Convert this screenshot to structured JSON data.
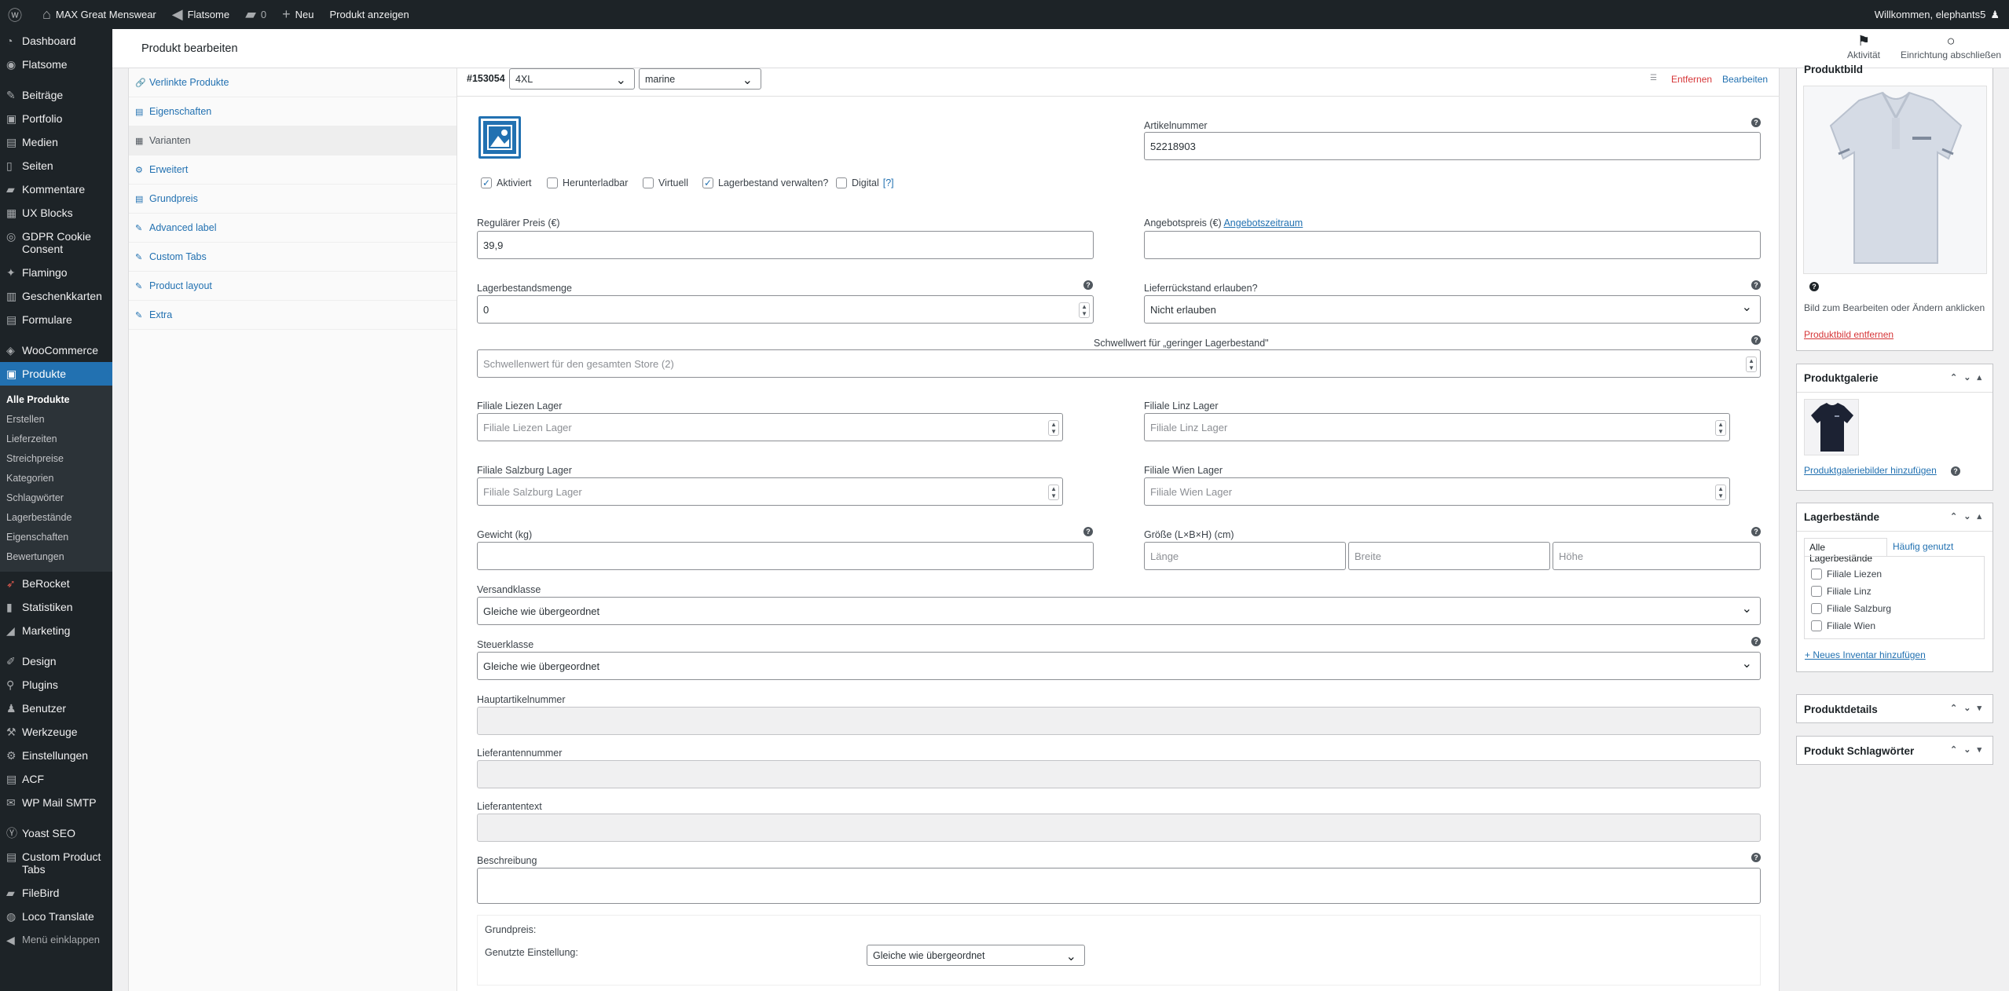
{
  "adminbar": {
    "site_name": "MAX Great Menswear",
    "theme": "Flatsome",
    "comments_count": "0",
    "new_label": "Neu",
    "view_product": "Produkt anzeigen",
    "greeting": "Willkommen, elephants5"
  },
  "menu": {
    "dashboard": "Dashboard",
    "flatsome": "Flatsome",
    "beitraege": "Beiträge",
    "portfolio": "Portfolio",
    "medien": "Medien",
    "seiten": "Seiten",
    "kommentare": "Kommentare",
    "ux_blocks": "UX Blocks",
    "gdpr": "GDPR Cookie Consent",
    "flamingo": "Flamingo",
    "geschenkkarten": "Geschenkkarten",
    "formulare": "Formulare",
    "woocommerce": "WooCommerce",
    "produkte": "Produkte",
    "submenu": [
      "Alle Produkte",
      "Erstellen",
      "Lieferzeiten",
      "Streichpreise",
      "Kategorien",
      "Schlagwörter",
      "Lagerbestände",
      "Eigenschaften",
      "Bewertungen"
    ],
    "berocket": "BeRocket",
    "statistiken": "Statistiken",
    "marketing": "Marketing",
    "design": "Design",
    "plugins": "Plugins",
    "benutzer": "Benutzer",
    "werkzeuge": "Werkzeuge",
    "einstellungen": "Einstellungen",
    "acf": "ACF",
    "wp_mail": "WP Mail SMTP",
    "yoast": "Yoast SEO",
    "custom_tabs": "Custom Product Tabs",
    "filebird": "FileBird",
    "loco": "Loco Translate",
    "collapse": "Menü einklappen"
  },
  "header": {
    "title": "Produkt bearbeiten",
    "activity": "Aktivität",
    "setup": "Einrichtung abschließen"
  },
  "tabs": [
    "Verlinkte Produkte",
    "Eigenschaften",
    "Varianten",
    "Erweitert",
    "Grundpreis",
    "Advanced label",
    "Custom Tabs",
    "Product layout",
    "Extra"
  ],
  "variation": {
    "id": "#153054",
    "size": "4XL",
    "color": "marine",
    "remove": "Entfernen",
    "edit": "Bearbeiten",
    "sku_label": "Artikelnummer",
    "sku": "52218903",
    "cb_active": "Aktiviert",
    "cb_download": "Herunterladbar",
    "cb_virtual": "Virtuell",
    "cb_stock": "Lagerbestand verwalten?",
    "cb_digital": "Digital",
    "cb_digital_help": "[?]",
    "regular_price_label": "Regulärer Preis (€)",
    "regular_price": "39,9",
    "sale_price_label": "Angebotspreis (€)",
    "sale_schedule": "Angebotszeitraum",
    "stock_qty_label": "Lagerbestandsmenge",
    "stock_qty": "0",
    "backorder_label": "Lieferrückstand erlauben?",
    "backorder": "Nicht erlauben",
    "low_stock_label": "Schwellwert für „geringer Lagerbestand\"",
    "low_stock_placeholder": "Schwellenwert für den gesamten Store (2)",
    "liezen_label": "Filiale Liezen Lager",
    "liezen_ph": "Filiale Liezen Lager",
    "linz_label": "Filiale Linz Lager",
    "linz_ph": "Filiale Linz Lager",
    "salzburg_label": "Filiale Salzburg Lager",
    "salzburg_ph": "Filiale Salzburg Lager",
    "wien_label": "Filiale Wien Lager",
    "wien_ph": "Filiale Wien Lager",
    "weight_label": "Gewicht (kg)",
    "dims_label": "Größe (L×B×H) (cm)",
    "length_ph": "Länge",
    "width_ph": "Breite",
    "height_ph": "Höhe",
    "shipping_label": "Versandklasse",
    "shipping": "Gleiche wie übergeordnet",
    "tax_label": "Steuerklasse",
    "tax": "Gleiche wie übergeordnet",
    "main_sku_label": "Hauptartikelnummer",
    "supplier_no_label": "Lieferantennummer",
    "supplier_text_label": "Lieferantentext",
    "desc_label": "Beschreibung",
    "unit_price_title": "Grundpreis:",
    "unit_setting_label": "Genutzte Einstellung:",
    "unit_setting": "Gleiche wie übergeordnet"
  },
  "sidebar": {
    "image_box_title": "Produktbild",
    "image_hint": "Bild zum Bearbeiten oder Ändern anklicken",
    "remove_image": "Produktbild entfernen",
    "gallery_title": "Produktgalerie",
    "gallery_add": "Produktgaleriebilder hinzufügen",
    "stock_title": "Lagerbestände",
    "stock_tab_all": "Alle Lagerbestände",
    "stock_tab_used": "Häufig genutzt",
    "stores": [
      "Filiale Liezen",
      "Filiale Linz",
      "Filiale Salzburg",
      "Filiale Wien"
    ],
    "new_inventory": "+ Neues Inventar hinzufügen",
    "details_title": "Produktdetails",
    "tags_title": "Produkt Schlagwörter"
  }
}
